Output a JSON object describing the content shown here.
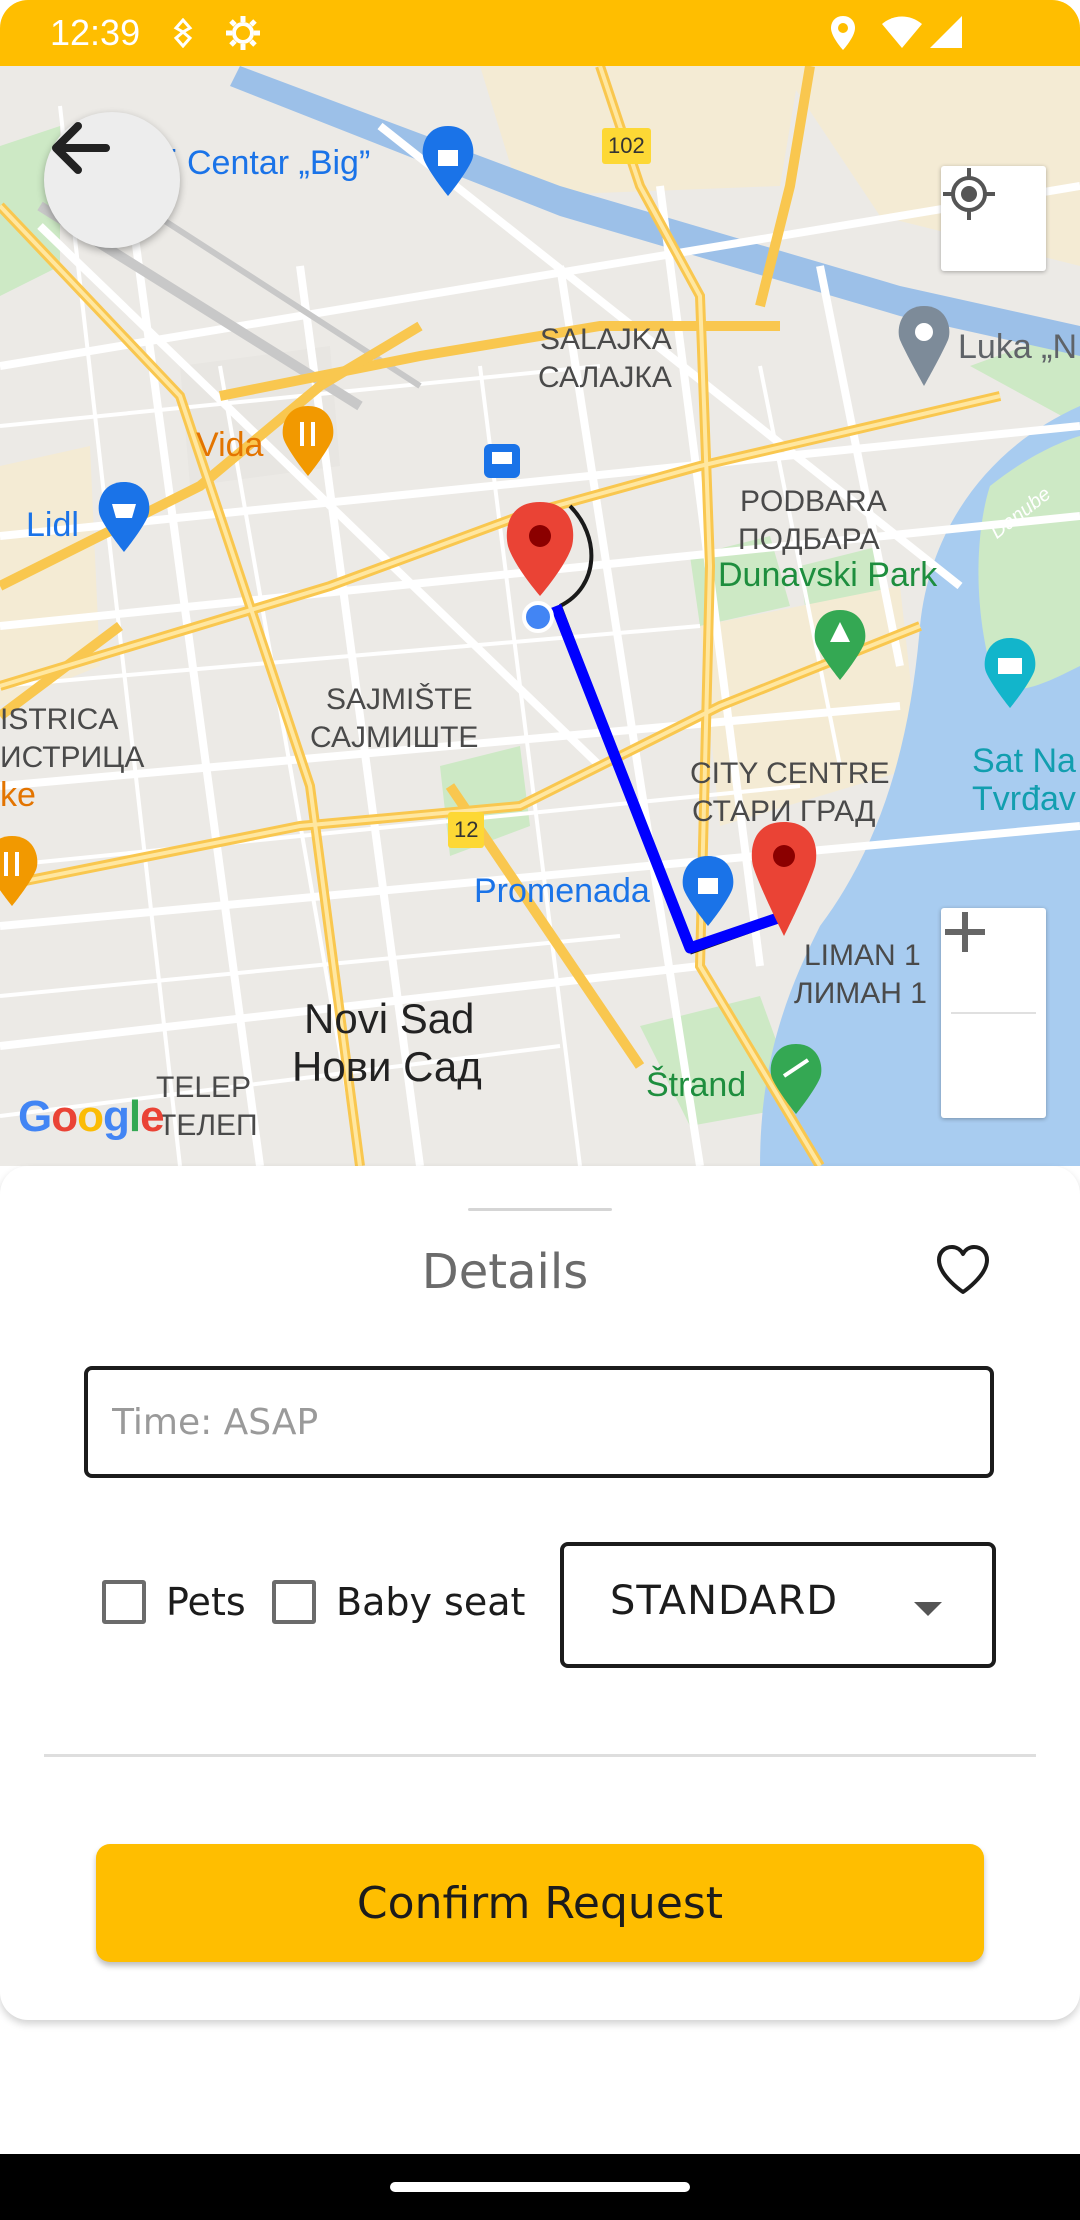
{
  "status_bar": {
    "time": "12:39",
    "icons": [
      "activity-icon",
      "settings-icon",
      "location-icon",
      "wifi-icon",
      "signal-icon"
    ]
  },
  "map": {
    "labels": {
      "city_center_big": "i Centar „Big”",
      "luka": "Luka „N",
      "salajka": "SALAJKA",
      "salajka_cyr": "САЛАЈКА",
      "vida": "Vida",
      "lidl": "Lidl",
      "podbara": "PODBARA",
      "podbara_cyr": "ПОДБАРА",
      "dunavski_park": "Dunavski Park",
      "danube": "Danube",
      "sajmiste": "SAJMIŠTE",
      "sajmiste_cyr": "САЈМИШТЕ",
      "bistrica": "ISTRICA",
      "bistrica_cyr": "ИСТРИЦА",
      "ke": "ke",
      "city_centre": "CITY CENTRE",
      "city_centre_cyr": "СТАРИ ГРАД",
      "sat_na": "Sat Na",
      "tvrdjava": "Tvrđav",
      "promenada": "Promenada",
      "liman": "LIMAN 1",
      "liman_cyr": "ЛИМАН 1",
      "novi_sad": "Novi Sad",
      "novi_sad_cyr": "Нови Сад",
      "telep": "TELEP",
      "telep_cyr": "ТЕЛЕП",
      "strand": "Štrand",
      "road_102": "102",
      "road_12": "12"
    },
    "attribution": "Google",
    "route_color": "#0000FF",
    "marker_color": "#E53935"
  },
  "sheet": {
    "title": "Details",
    "time_placeholder": "Time: ASAP",
    "pets_label": "Pets",
    "baby_seat_label": "Baby seat",
    "vehicle_type": "STANDARD",
    "confirm_label": "Confirm Request"
  },
  "colors": {
    "accent": "#FFBE00"
  }
}
